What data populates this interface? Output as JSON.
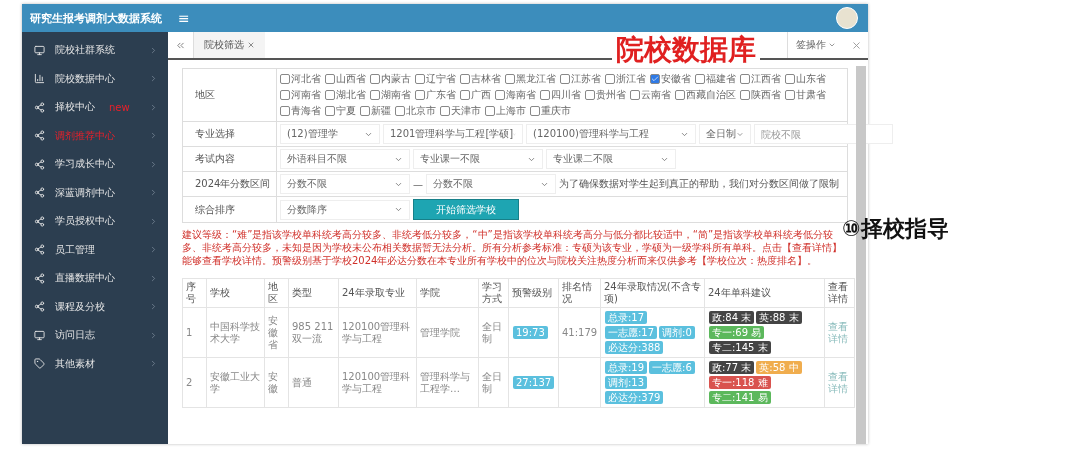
{
  "app": {
    "title": "研究生报考调剂大数据系统",
    "menu_glyph": "≡"
  },
  "annotations": {
    "overlay_title": "院校数据库",
    "side_caption": "⑩择校指导"
  },
  "sidebar": {
    "items": [
      {
        "label": "院校社群系统",
        "kind": "screen",
        "highlighted": false
      },
      {
        "label": "院校数据中心",
        "kind": "stats",
        "highlighted": false
      },
      {
        "label": "择校中心",
        "kind": "module",
        "highlighted": false,
        "badge": "new"
      },
      {
        "label": "调剂推荐中心",
        "kind": "module",
        "highlighted": true
      },
      {
        "label": "学习成长中心",
        "kind": "module",
        "highlighted": false
      },
      {
        "label": "深蓝调剂中心",
        "kind": "module",
        "highlighted": false
      },
      {
        "label": "学员授权中心",
        "kind": "module",
        "highlighted": false
      },
      {
        "label": "员工管理",
        "kind": "module",
        "highlighted": false
      },
      {
        "label": "直播数据中心",
        "kind": "module",
        "highlighted": false
      },
      {
        "label": "课程及分校",
        "kind": "module",
        "highlighted": false
      },
      {
        "label": "访问日志",
        "kind": "screen",
        "highlighted": false
      },
      {
        "label": "其他素材",
        "kind": "assets",
        "highlighted": false
      }
    ]
  },
  "tabs": [
    {
      "label": "院校筛选",
      "selected": true
    }
  ],
  "tab_actions": "签操作",
  "filters": {
    "region": {
      "label": "地区",
      "provinces": [
        {
          "name": "河北省",
          "checked": false
        },
        {
          "name": "山西省",
          "checked": false
        },
        {
          "name": "内蒙古",
          "checked": false
        },
        {
          "name": "辽宁省",
          "checked": false
        },
        {
          "name": "吉林省",
          "checked": false
        },
        {
          "name": "黑龙江省",
          "checked": false
        },
        {
          "name": "江苏省",
          "checked": false
        },
        {
          "name": "浙江省",
          "checked": false
        },
        {
          "name": "安徽省",
          "checked": true
        },
        {
          "name": "福建省",
          "checked": false
        },
        {
          "name": "江西省",
          "checked": false
        },
        {
          "name": "山东省",
          "checked": false
        },
        {
          "name": "河南省",
          "checked": false
        },
        {
          "name": "湖北省",
          "checked": false
        },
        {
          "name": "湖南省",
          "checked": false
        },
        {
          "name": "广东省",
          "checked": false
        },
        {
          "name": "广西",
          "checked": false
        },
        {
          "name": "海南省",
          "checked": false
        },
        {
          "name": "四川省",
          "checked": false
        },
        {
          "name": "贵州省",
          "checked": false
        },
        {
          "name": "云南省",
          "checked": false
        },
        {
          "name": "西藏自治区",
          "checked": false
        },
        {
          "name": "陕西省",
          "checked": false
        },
        {
          "name": "甘肃省",
          "checked": false
        },
        {
          "name": "青海省",
          "checked": false
        },
        {
          "name": "宁夏",
          "checked": false
        },
        {
          "name": "新疆",
          "checked": false
        },
        {
          "name": "北京市",
          "checked": false
        },
        {
          "name": "天津市",
          "checked": false
        },
        {
          "name": "上海市",
          "checked": false
        },
        {
          "name": "重庆市",
          "checked": false
        }
      ]
    },
    "major": {
      "label": "专业选择",
      "selects": [
        "(12)管理学",
        "1201管理科学与工程[学硕]",
        "(120100)管理科学与工程",
        "全日制"
      ],
      "school_placeholder": "院校不限"
    },
    "exam": {
      "label": "考试内容",
      "selects": [
        "外语科目不限",
        "专业课一不限",
        "专业课二不限"
      ]
    },
    "score": {
      "label": "2024年分数区间",
      "from": "分数不限",
      "separator": "—",
      "to": "分数不限",
      "note": "为了确保数据对学生起到真正的帮助，我们对分数区间做了限制"
    },
    "sort": {
      "label": "综合排序",
      "select": "分数降序",
      "button": "开始筛选学校"
    }
  },
  "notice": "建议等级：“难”是指该学校单科统考高分较多、非统考低分较多，“中”是指该学校单科统考高分与低分都比较适中，“简”是指该学校单科统考低分较多、非统考高分较多，未知是因为学校未公布相关数据暂无法分析。所有分析参考标准：专硕为该专业，学硕为一级学科所有单科。点击【查看详情】能够查看学校详情。预警级别基于学校2024年必达分数在本专业所有学校中的位次与院校关注热度分析而来仅供参考【学校位次：热度排名】。",
  "table": {
    "columns": [
      "序号",
      "学校",
      "地区",
      "类型",
      "24年录取专业",
      "学院",
      "学习方式",
      "预警级别",
      "排名情况",
      "24年录取情况(不含专项)",
      "24年单科建议",
      "查看详情"
    ],
    "rows": [
      {
        "index": "1",
        "school": "中国科学技术大学",
        "region": "安徽省",
        "type": "985 211 双一流",
        "major": "120100管理科学与工程",
        "college": "管理学院",
        "mode": "全日制",
        "warning": "19:73",
        "rank": "41:179",
        "admission": [
          "总录:17",
          "一志愿:17",
          "调剂:0",
          "必达分:388"
        ],
        "subjects": [
          {
            "text": "政:84 末",
            "color": "#444444"
          },
          {
            "text": "英:88 末",
            "color": "#444444"
          },
          {
            "text": "专一:69 易",
            "color": "#5cb85c"
          },
          {
            "text": "专二:145 末",
            "color": "#444444"
          }
        ],
        "details": "查看详情"
      },
      {
        "index": "2",
        "school": "安徽工业大学",
        "region": "安徽",
        "type": "普通",
        "major": "120100管理科学与工程",
        "college": "管理科学与工程学…",
        "mode": "全日制",
        "warning": "27:137",
        "admission": [
          "总录:19",
          "一志愿:6",
          "调剂:13",
          "必达分:379"
        ],
        "subjects": [
          {
            "text": "政:77 末",
            "color": "#444444"
          },
          {
            "text": "英:58 中",
            "color": "#f0ad4e"
          },
          {
            "text": "专一:118 难",
            "color": "#d9534f"
          },
          {
            "text": "专二:141 易",
            "color": "#5cb85c"
          }
        ],
        "details": "查看详情"
      }
    ]
  }
}
